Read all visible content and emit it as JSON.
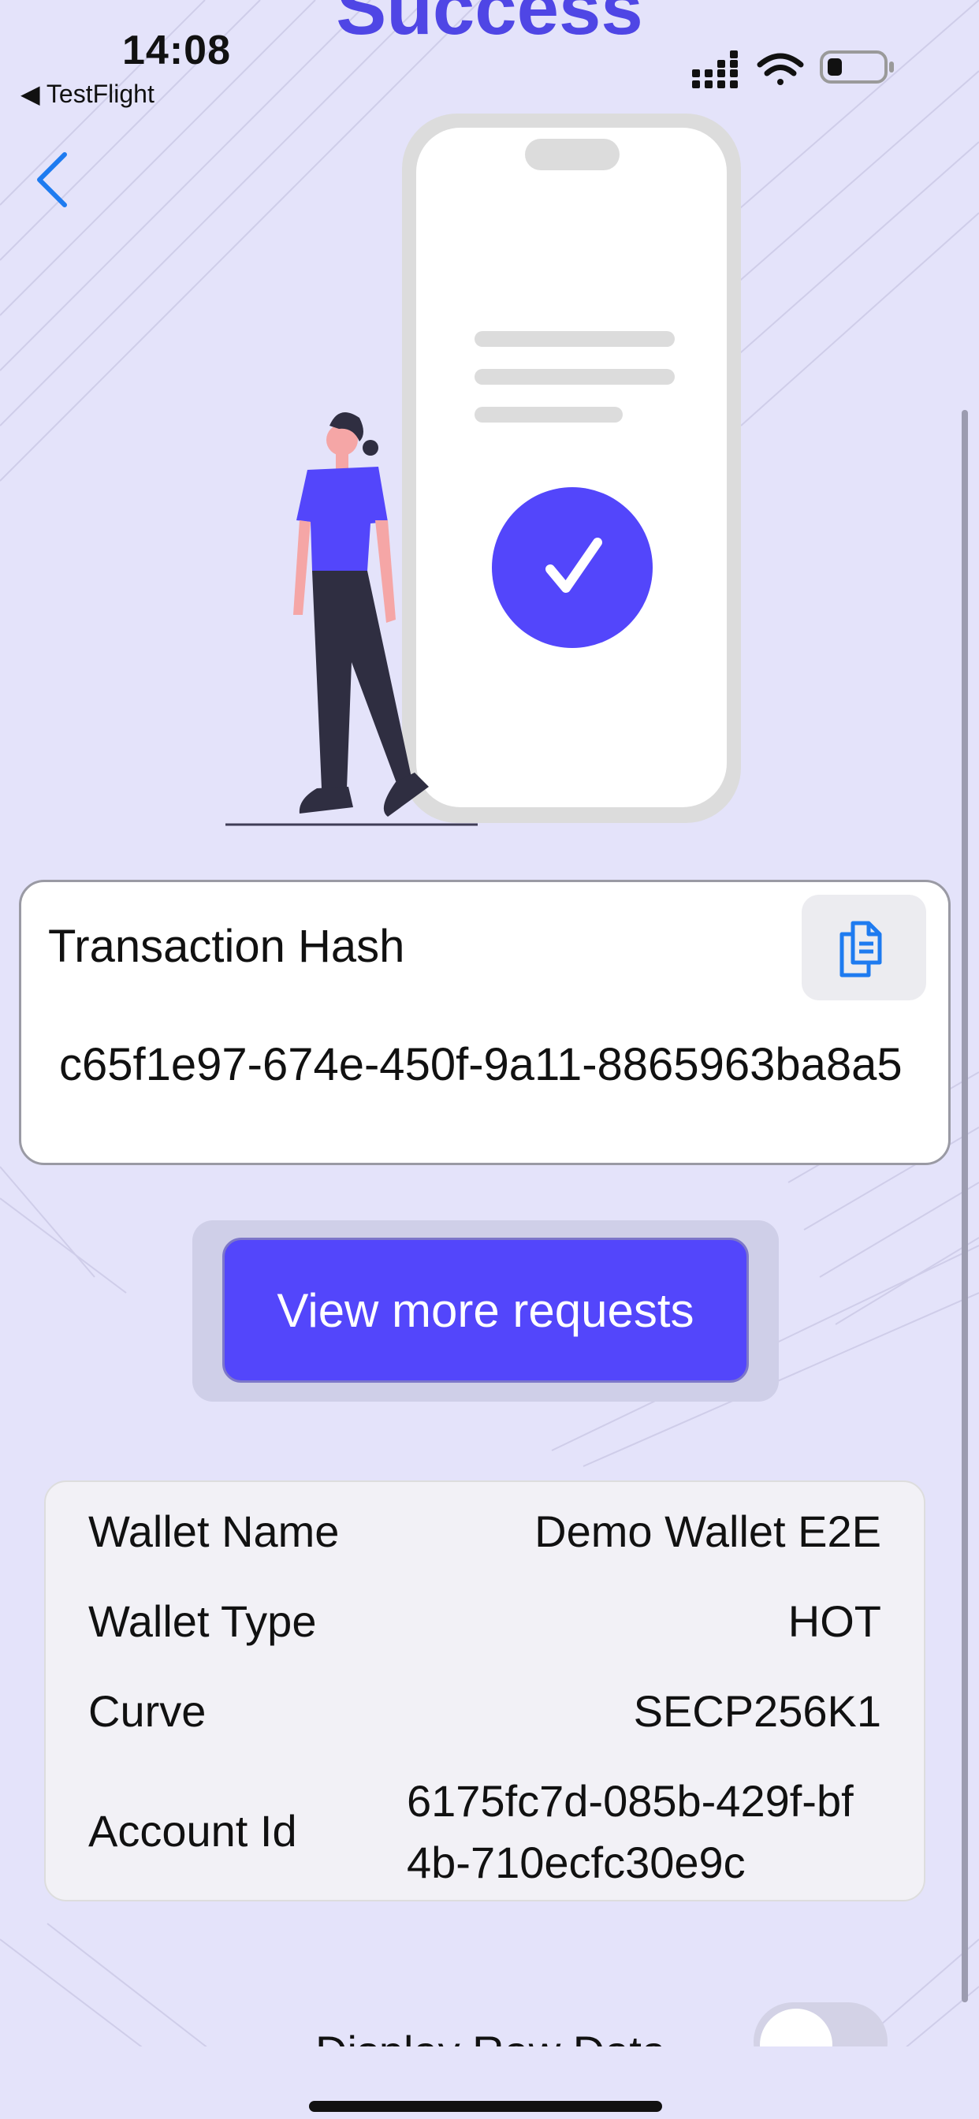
{
  "status_bar": {
    "time": "14:08",
    "back_app": "TestFlight"
  },
  "header": {
    "title": "Success"
  },
  "transaction": {
    "label": "Transaction Hash",
    "hash": "c65f1e97-674e-450f-9a11-8865963ba8a5",
    "copy_icon": "copy-icon"
  },
  "actions": {
    "view_more": "View more requests"
  },
  "wallet_info": {
    "rows": [
      {
        "label": "Wallet Name",
        "value": "Demo Wallet E2E"
      },
      {
        "label": "Wallet Type",
        "value": "HOT"
      },
      {
        "label": "Curve",
        "value": "SECP256K1"
      },
      {
        "label": "Account Id",
        "value": "6175fc7d-085b-429f-bf4b-710ecfc30e9c"
      }
    ]
  },
  "raw_data": {
    "label": "Display Raw Data",
    "toggle_on": false
  },
  "colors": {
    "accent": "#5346fb",
    "background": "#e4e3fa",
    "link": "#1e7bf0"
  }
}
